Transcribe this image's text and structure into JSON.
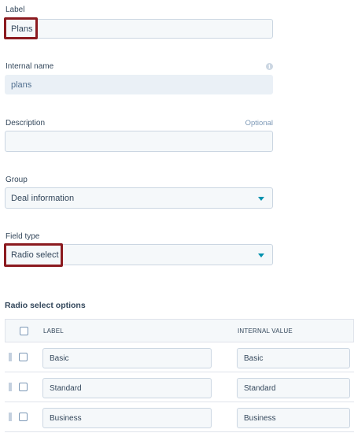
{
  "form": {
    "label_field": {
      "label": "Label",
      "value": "Plans"
    },
    "internal_name": {
      "label": "Internal name",
      "value": "plans"
    },
    "description": {
      "label": "Description",
      "optional_text": "Optional",
      "value": ""
    },
    "group": {
      "label": "Group",
      "value": "Deal information"
    },
    "field_type": {
      "label": "Field type",
      "value": "Radio select"
    }
  },
  "options": {
    "title": "Radio select options",
    "headers": {
      "label": "LABEL",
      "internal_value": "INTERNAL VALUE"
    },
    "rows": [
      {
        "label": "Basic",
        "internal_value": "Basic"
      },
      {
        "label": "Standard",
        "internal_value": "Standard"
      },
      {
        "label": "Business",
        "internal_value": "Business"
      }
    ]
  },
  "icons": {
    "info": "info-icon",
    "dropdown": "caret-down-icon",
    "drag": "drag-handle-icon"
  },
  "colors": {
    "highlight": "#8b1a1f",
    "accent": "#0091ae",
    "field_bg": "#f5f8fa",
    "text": "#33475b"
  }
}
